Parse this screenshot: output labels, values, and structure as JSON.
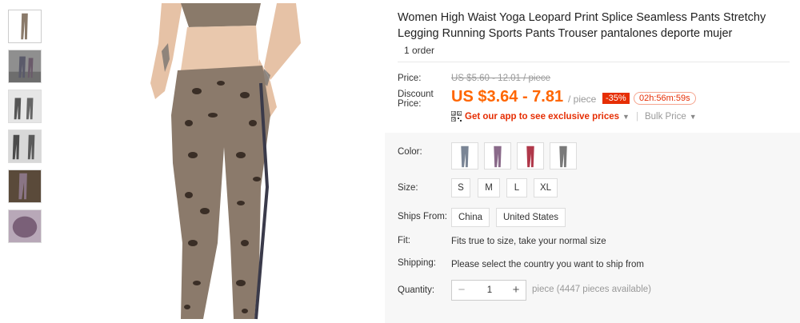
{
  "product": {
    "title": "Women High Waist Yoga Leopard Print Splice Seamless Pants Stretchy Legging Running Sports Pants Trouser pantalones deporte mujer",
    "orders": "1 order"
  },
  "thumbnails": [
    {
      "name": "thumb-1"
    },
    {
      "name": "thumb-2"
    },
    {
      "name": "thumb-3"
    },
    {
      "name": "thumb-4"
    },
    {
      "name": "thumb-5"
    },
    {
      "name": "thumb-6"
    }
  ],
  "price": {
    "price_label": "Price:",
    "original": "US $5.60 - 12.01 / piece",
    "discount_label": "Discount Price:",
    "discount_label_1": "Discount",
    "discount_label_2": "Price:",
    "discounted": "US $3.64 - 7.81",
    "per_piece": "/ piece",
    "discount_badge": "-35%",
    "timer": "02h:56m:59s",
    "app_link": "Get our app to see exclusive prices",
    "bulk_price": "Bulk Price",
    "colors": {
      "accent": "#f60",
      "badge": "#e62e04"
    }
  },
  "options": {
    "color_label": "Color:",
    "size_label": "Size:",
    "sizes": [
      "S",
      "M",
      "L",
      "XL"
    ],
    "ships_from_label": "Ships From:",
    "ships_from": [
      "China",
      "United States"
    ],
    "fit_label": "Fit:",
    "fit_value": "Fits true to size, take your normal size",
    "shipping_label": "Shipping:",
    "shipping_value": "Please select the country you want to ship from",
    "quantity_label": "Quantity:",
    "quantity_minus": "−",
    "quantity_value": "1",
    "quantity_plus": "+",
    "quantity_unit": "piece",
    "quantity_available": "(4447 pieces available)"
  }
}
